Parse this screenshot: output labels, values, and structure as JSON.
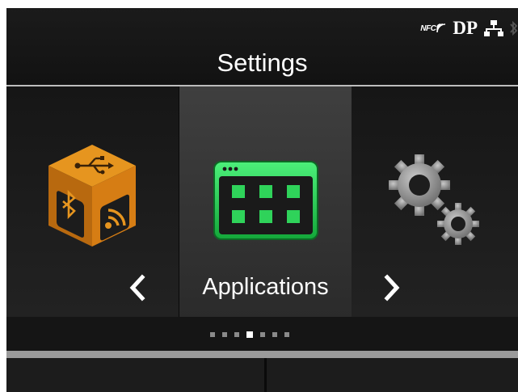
{
  "header": {
    "title": "Settings",
    "status": {
      "nfc_label": "NFC",
      "dp_label": "DP"
    }
  },
  "carousel": {
    "items": [
      {
        "name": "Interface",
        "icon": "interface-cube-icon",
        "selected": false
      },
      {
        "label": "Applications",
        "icon": "applications-window-icon",
        "selected": true
      },
      {
        "name": "Settings gears",
        "icon": "gears-icon",
        "selected": false
      }
    ],
    "page_count": 7,
    "current_page": 4
  },
  "softkeys": {
    "left_label": "",
    "right_label": ""
  },
  "colors": {
    "accent_green": "#2fd35a",
    "interface_orange": "#e08a1c",
    "background": "#0d0d0d"
  }
}
